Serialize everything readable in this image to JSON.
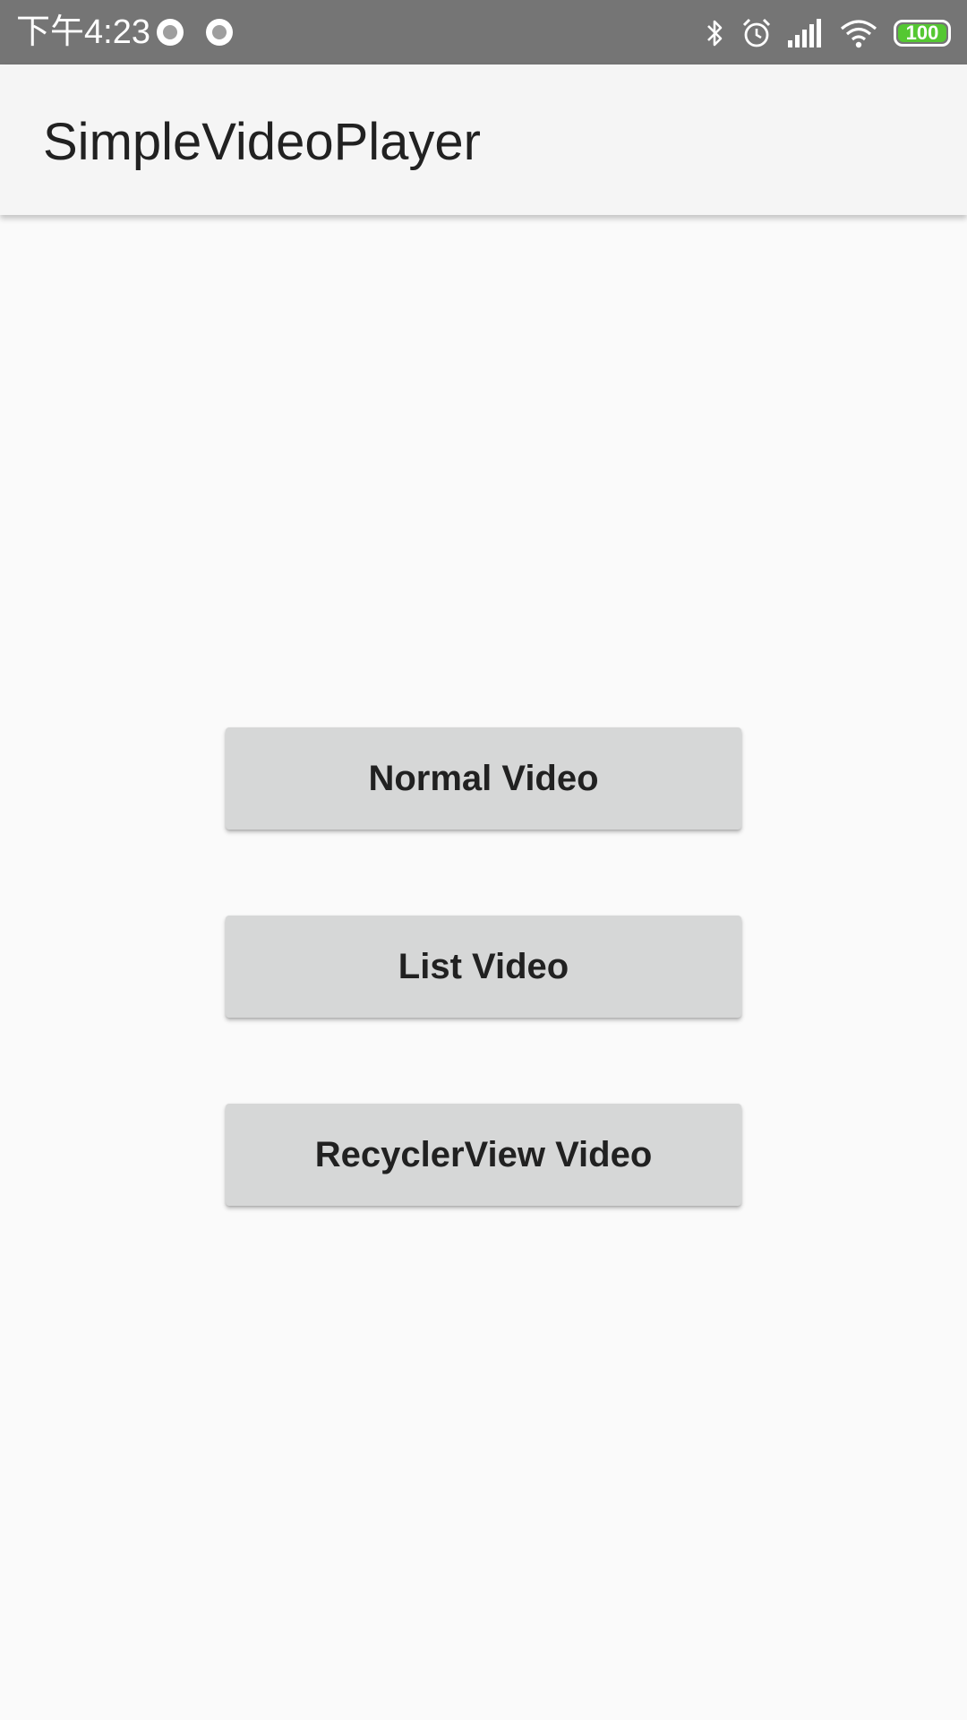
{
  "status_bar": {
    "time": "下午4:23",
    "notification_icons": [
      "record-icon",
      "record-icon"
    ],
    "right_icons": [
      "bluetooth-icon",
      "alarm-icon",
      "signal-icon",
      "wifi-icon"
    ],
    "battery_level": "100",
    "battery_color": "#55c832",
    "background": "#757575"
  },
  "app_bar": {
    "title": "SimpleVideoPlayer",
    "background": "#f5f5f5"
  },
  "main": {
    "buttons": [
      {
        "label": "Normal Video"
      },
      {
        "label": "List Video"
      },
      {
        "label": "RecyclerView Video"
      }
    ],
    "button_color": "#d6d7d7"
  }
}
